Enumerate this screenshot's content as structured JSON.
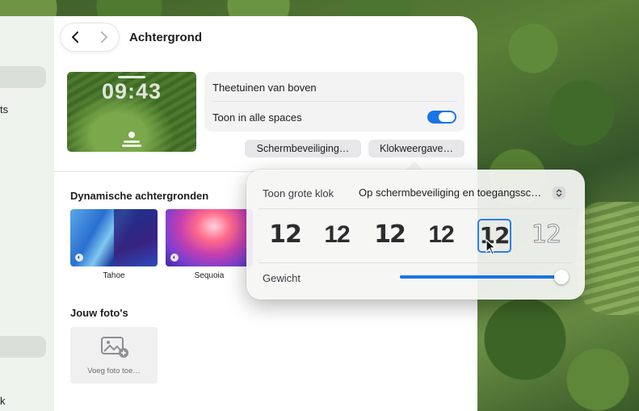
{
  "sidebar": {
    "fragments": [
      "ts",
      "k"
    ]
  },
  "window": {
    "title": "Achtergrond"
  },
  "preview": {
    "time": "09:43"
  },
  "wallpaper_info": {
    "name": "Theetuinen van boven",
    "show_all_spaces_label": "Toon in alle spaces",
    "show_all_spaces_on": true
  },
  "buttons": {
    "screensaver": "Schermbeveiliging…",
    "clock_style": "Klokweergave…"
  },
  "dynamic": {
    "title": "Dynamische achtergronden",
    "items": [
      {
        "caption": "Tahoe"
      },
      {
        "caption": "Sequoia"
      }
    ]
  },
  "photos": {
    "title": "Jouw foto's",
    "add_label": "Voeg foto toe…"
  },
  "clock_popover": {
    "big_clock_label": "Toon grote klok",
    "big_clock_value": "Op schermbeveiliging en toegangssc…",
    "styles": [
      "12",
      "12",
      "12",
      "12",
      "12",
      "12"
    ],
    "selected_index": 4,
    "weight_label": "Gewicht",
    "weight_value": 1.0
  },
  "colors": {
    "accent": "#1a73e8",
    "selection_border": "#2f7df0"
  }
}
